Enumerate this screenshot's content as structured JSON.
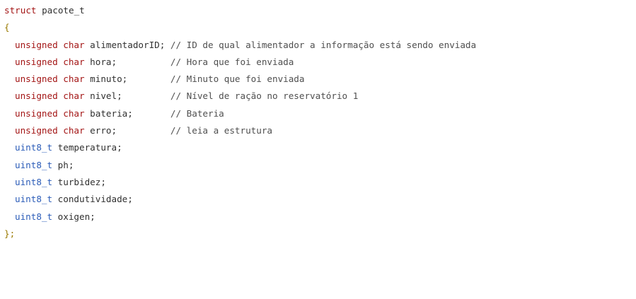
{
  "code": {
    "struct_keyword": "struct",
    "struct_name": "pacote_t",
    "open_brace": "{",
    "close_brace": "};",
    "fields": [
      {
        "type": "unsigned char",
        "decl": "alimentadorID;",
        "pad": " ",
        "comment": "// ID de qual alimentador a informação está sendo enviada"
      },
      {
        "type": "unsigned char",
        "decl": "hora;",
        "pad": "          ",
        "comment": "// Hora que foi enviada"
      },
      {
        "type": "unsigned char",
        "decl": "minuto;",
        "pad": "        ",
        "comment": "// Minuto que foi enviada"
      },
      {
        "type": "unsigned char",
        "decl": "nivel;",
        "pad": "         ",
        "comment": "// Nível de ração no reservatório 1"
      },
      {
        "type": "unsigned char",
        "decl": "bateria;",
        "pad": "       ",
        "comment": "// Bateria"
      },
      {
        "type": "unsigned char",
        "decl": "erro;",
        "pad": "          ",
        "comment": "// leia a estrutura"
      },
      {
        "type": "uint8_t",
        "decl": "temperatura;",
        "pad": "",
        "comment": ""
      },
      {
        "type": "uint8_t",
        "decl": "ph;",
        "pad": "",
        "comment": ""
      },
      {
        "type": "uint8_t",
        "decl": "turbidez;",
        "pad": "",
        "comment": ""
      },
      {
        "type": "uint8_t",
        "decl": "condutividade;",
        "pad": "",
        "comment": ""
      },
      {
        "type": "uint8_t",
        "decl": "oxigen;",
        "pad": "",
        "comment": ""
      }
    ]
  },
  "colors": {
    "keyword": "#a31515",
    "custom_type": "#2b5cb8",
    "identifier": "#303030",
    "comment": "#4f4f4f",
    "brace": "#9a7a00",
    "background": "#ffffff"
  }
}
